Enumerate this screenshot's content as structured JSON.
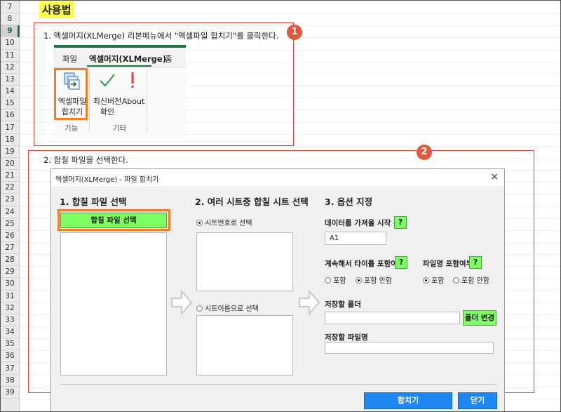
{
  "rows": [
    "7",
    "8",
    "9",
    "10",
    "11",
    "12",
    "13",
    "14",
    "15",
    "16",
    "17",
    "18",
    "19",
    "20",
    "21",
    "22",
    "23",
    "24",
    "25",
    "26",
    "27",
    "28",
    "29",
    "30",
    "31",
    "32",
    "33",
    "34",
    "35",
    "36",
    "37",
    "38",
    "39"
  ],
  "selected_row": "9",
  "title": "사용법",
  "step1": {
    "badge": "1",
    "text": "1. 엑셀머지(XLMerge) 리본메뉴에서 \"엑셀파일 합치기\"를 클릭한다."
  },
  "ribbon": {
    "tabs": [
      "파일",
      "엑셀머지(XLMerge)",
      "홈"
    ],
    "merge_label_1": "엑셀파일",
    "merge_label_2": "합치기",
    "update_label_1": "최신버전",
    "update_label_2": "확인",
    "about_label": "About",
    "group_1": "기능",
    "group_2": "기타",
    "accent": "#217346"
  },
  "step2": {
    "badge": "2",
    "text": "2. 합칠 파일을 선택한다."
  },
  "dialog": {
    "title": "엑셀머지(XLMerge) - 파일 합치기",
    "close": "×",
    "sec1_title": "1. 합칠 파일 선택",
    "select_files_button": "합칠 파일 선택",
    "sec2_title": "2. 여러 시트중 합칠 시트 선택",
    "radio_sheet_number": "시트번호로 선택",
    "radio_sheet_name": "시트이름으로 선택",
    "sec3_title": "3. 옵션 지정",
    "start_pos_label": "데이터를 가져올 시작 위치",
    "start_pos_value": "A1",
    "help": "?",
    "continue_title_label": "계속해서 타이틀 포함여부",
    "filename_label": "파일명 포함여부",
    "include": "포함",
    "exclude": "포함 안함",
    "save_folder_label": "저장할 폴더",
    "change_folder_button": "폴더 변경",
    "save_filename_label": "저장할 파일명",
    "merge_button": "합치기",
    "close_button": "닫기"
  },
  "colors": {
    "highlight": "#ffff4d",
    "red": "#d9443a",
    "orange": "#ef7f2a",
    "green_button": "#7dff63",
    "blue_button": "#1e88f0"
  }
}
